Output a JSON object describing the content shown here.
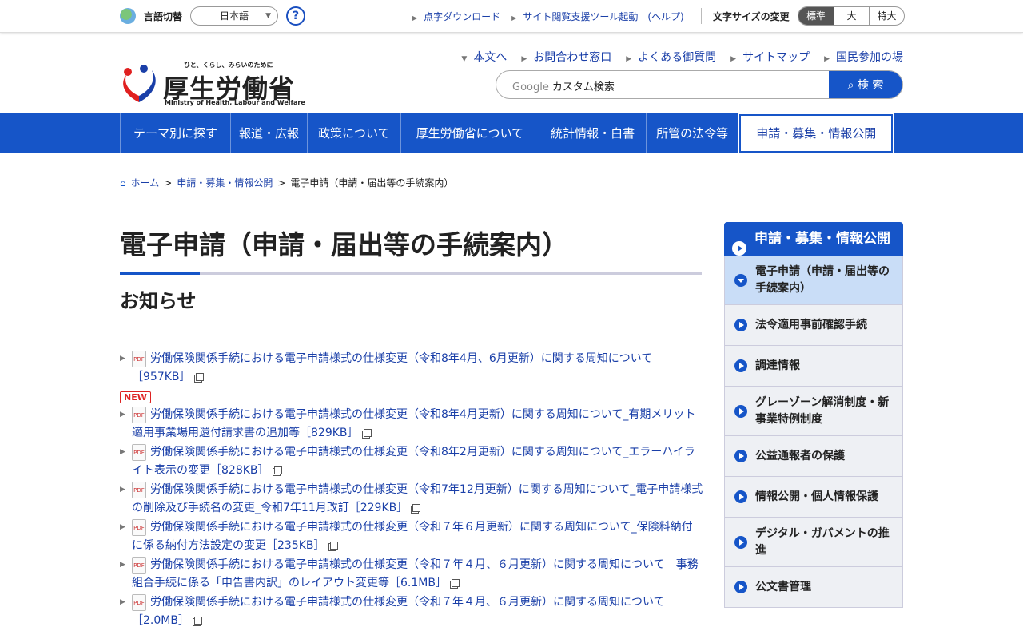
{
  "topbar": {
    "lang_label": "言語切替",
    "lang_value": "日本語",
    "help": "?",
    "links": [
      "点字ダウンロード",
      "サイト閲覧支援ツール起動　(ヘルプ)"
    ],
    "font_size_label": "文字サイズの変更",
    "font_sizes": [
      "標準",
      "大",
      "特大"
    ]
  },
  "logo": {
    "tagline": "ひと、くらし、みらいのために",
    "name": "厚生労働省",
    "english": "Ministry of Health, Labour and Welfare"
  },
  "header_links": [
    "本文へ",
    "お問合わせ窓口",
    "よくある御質問",
    "サイトマップ",
    "国民参加の場"
  ],
  "search": {
    "brand": "Google",
    "placeholder": "カスタム検索",
    "button": "検 索"
  },
  "nav": [
    "テーマ別に探す",
    "報道・広報",
    "政策について",
    "厚生労働省について",
    "統計情報・白書",
    "所管の法令等",
    "申請・募集・情報公開"
  ],
  "breadcrumb": [
    "ホーム",
    "申請・募集・情報公開",
    "電子申請（申請・届出等の手続案内）"
  ],
  "page_title": "電子申請（申請・届出等の手続案内）",
  "section_title": "お知らせ",
  "new_badge": "NEW",
  "pdf_label": "PDF",
  "notices": [
    "労働保険関係手続における電子申請様式の仕様変更（令和8年4月、6月更新）に関する周知について［957KB］",
    "労働保険関係手続における電子申請様式の仕様変更（令和8年4月更新）に関する周知について_有期メリット適用事業場用還付請求書の追加等［829KB］",
    "労働保険関係手続における電子申請様式の仕様変更（令和8年2月更新）に関する周知について_エラーハイライト表示の変更［828KB］",
    "労働保険関係手続における電子申請様式の仕様変更（令和7年12月更新）に関する周知について_電子申請様式の削除及び手続名の変更_令和7年11月改訂［229KB］",
    "労働保険関係手続における電子申請様式の仕様変更（令和７年６月更新）に関する周知について_保険料納付に係る納付方法設定の変更［235KB］",
    "労働保険関係手続における電子申請様式の仕様変更（令和７年４月、６月更新）に関する周知について　事務組合手続に係る「申告書内訳」のレイアウト変更等［6.1MB］",
    "労働保険関係手続における電子申請様式の仕様変更（令和７年４月、６月更新）に関する周知について［2.0MB］"
  ],
  "sidebar": {
    "title": "申請・募集・情報公開",
    "items": [
      "電子申請（申請・届出等の手続案内）",
      "法令適用事前確認手続",
      "調達情報",
      "グレーゾーン解消制度・新事業特例制度",
      "公益通報者の保護",
      "情報公開・個人情報保護",
      "デジタル・ガバメントの推進",
      "公文書管理"
    ]
  }
}
